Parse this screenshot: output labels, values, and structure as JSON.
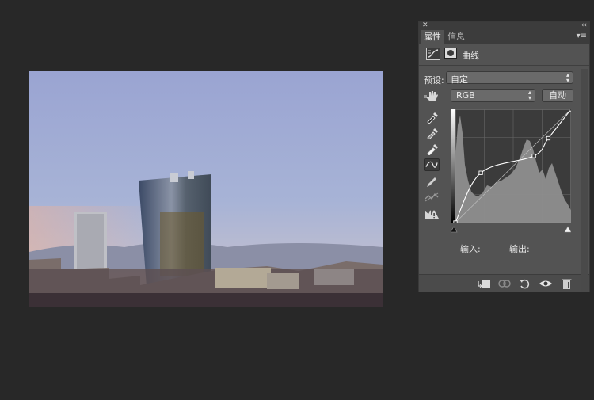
{
  "panel": {
    "tabs": [
      {
        "label": "属性"
      },
      {
        "label": "信息"
      }
    ],
    "adjustment_title": "曲线",
    "preset": {
      "label": "预设:",
      "value": "自定"
    },
    "channel": {
      "value": "RGB"
    },
    "auto_label": "自动",
    "input_label": "输入:",
    "output_label": "输出:"
  },
  "curve": {
    "points": [
      [
        0,
        0
      ],
      [
        56,
        112
      ],
      [
        173,
        150
      ],
      [
        205,
        190
      ],
      [
        255,
        255
      ]
    ]
  },
  "colors": {
    "panel_bg": "#535353",
    "workspace_bg": "#282828",
    "curve_line": "#ffffff"
  },
  "icons": [
    "close-icon",
    "collapse-icon",
    "panel-menu-icon",
    "curves-adjustment-icon",
    "mask-icon",
    "hand-tool-icon",
    "eyedropper-black-icon",
    "eyedropper-gray-icon",
    "eyedropper-white-icon",
    "curve-smooth-icon",
    "pencil-icon",
    "smooth-curve-icon",
    "clipping-warning-icon",
    "clip-to-layer-icon",
    "view-previous-icon",
    "reset-icon",
    "visibility-icon",
    "trash-icon"
  ]
}
